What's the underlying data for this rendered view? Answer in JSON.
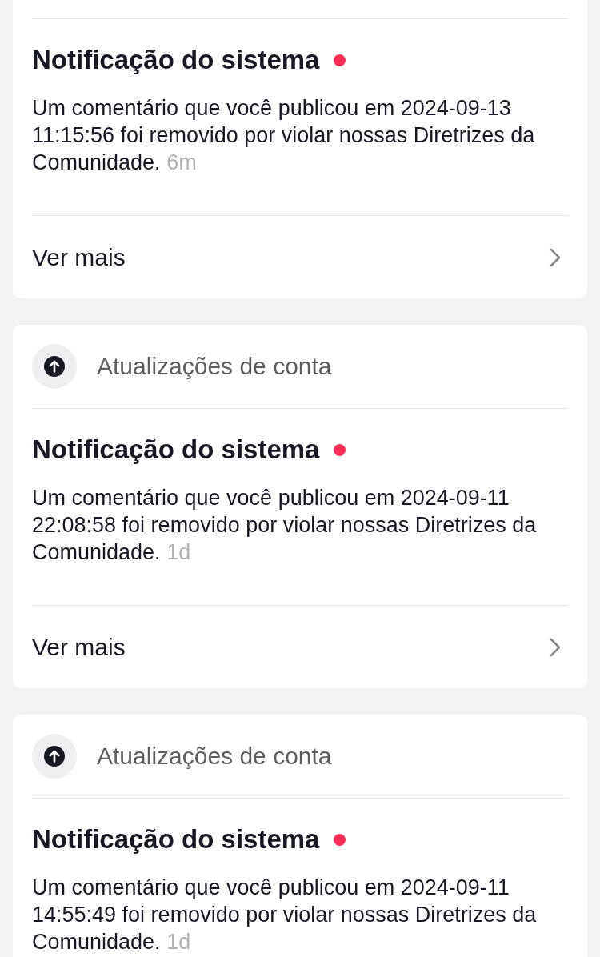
{
  "cards": [
    {
      "title": "Notificação do sistema",
      "unread": true,
      "message": "Um comentário que você publicou em 2024-09-13 11:15:56 foi removido por violar nossas Diretrizes da Comunidade.",
      "time": "6m",
      "footer": {
        "label": "Ver mais"
      }
    },
    {
      "header": {
        "label": "Atualizações de conta"
      },
      "title": "Notificação do sistema",
      "unread": true,
      "message": "Um comentário que você publicou em 2024-09-11 22:08:58 foi removido por violar nossas Diretrizes da Comunidade.",
      "time": "1d",
      "footer": {
        "label": "Ver mais"
      }
    },
    {
      "header": {
        "label": "Atualizações de conta"
      },
      "title": "Notificação do sistema",
      "unread": true,
      "message": "Um comentário que você publicou em 2024-09-11 14:55:49 foi removido por violar nossas Diretrizes da Comunidade.",
      "time": "1d"
    }
  ]
}
